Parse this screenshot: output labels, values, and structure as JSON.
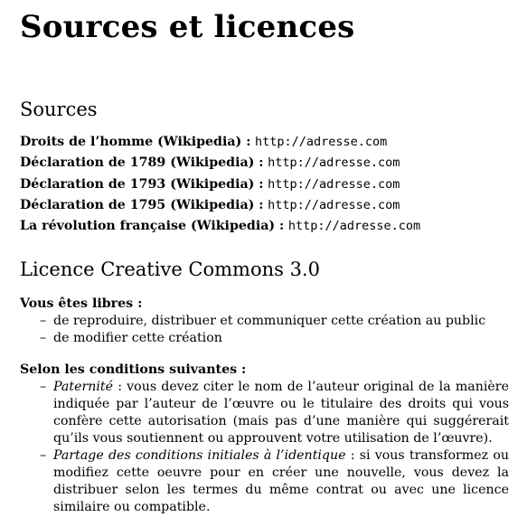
{
  "title": "Sources et licences",
  "sources": {
    "heading": "Sources",
    "items": [
      {
        "label": "Droits de l’homme (Wikipedia) :",
        "url": "http://adresse.com"
      },
      {
        "label": "Déclaration de 1789 (Wikipedia) :",
        "url": "http://adresse.com"
      },
      {
        "label": "Déclaration de 1793 (Wikipedia) :",
        "url": "http://adresse.com"
      },
      {
        "label": "Déclaration de 1795 (Wikipedia) :",
        "url": "http://adresse.com"
      },
      {
        "label": "La révolution française (Wikipedia) :",
        "url": "http://adresse.com"
      }
    ]
  },
  "licence": {
    "heading": "Licence Creative Commons 3.0",
    "free_heading": "Vous êtes libres :",
    "free_items": [
      "de reproduire, distribuer et communiquer cette création au public",
      "de modifier cette création"
    ],
    "conditions_heading": "Selon les conditions suivantes :",
    "conditions": [
      {
        "term": "Paternité",
        "text": " : vous devez citer le nom de l’auteur original de la manière indiquée par l’auteur de l’œuvre ou le titulaire des droits qui vous confère cette autorisation (mais pas d’une manière qui suggérerait qu’ils vous soutiennent ou approuvent votre utilisation de l’œuvre)."
      },
      {
        "term": "Partage des conditions initiales à l’identique",
        "text": " : si vous transformez ou modifiez cette oeuvre pour en créer une nouvelle, vous devez la distribuer selon les termes du même contrat ou avec une licence similaire ou compatible."
      }
    ],
    "dash": "–"
  }
}
